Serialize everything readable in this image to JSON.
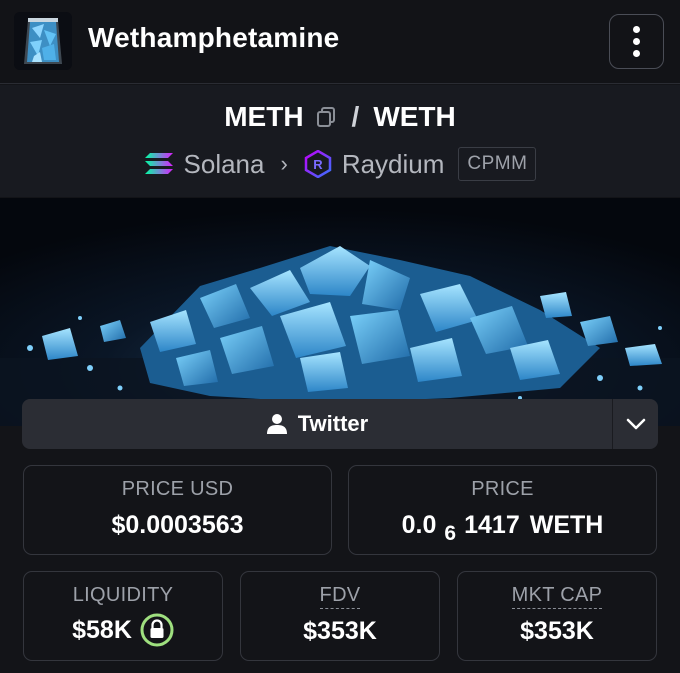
{
  "header": {
    "token_name": "Wethamphetamine",
    "menu_icon": "more-vertical-icon"
  },
  "pair": {
    "base": "METH",
    "separator": "/",
    "quote": "WETH",
    "chain": "Solana",
    "dex": "Raydium",
    "pool_type": "CPMM"
  },
  "social": {
    "twitter_label": "Twitter"
  },
  "stats": {
    "price_usd_label": "PRICE USD",
    "price_usd_value": "$0.0003563",
    "price_label": "PRICE",
    "price_prefix": "0.0",
    "price_zero_count": "6",
    "price_digits": "1417",
    "price_unit": "WETH",
    "liquidity_label": "LIQUIDITY",
    "liquidity_value": "$58K",
    "fdv_label": "FDV",
    "fdv_value": "$353K",
    "mktcap_label": "MKT CAP",
    "mktcap_value": "$353K"
  },
  "colors": {
    "background": "#131418",
    "card_border": "#34363d",
    "lock_green": "#9fe07f",
    "crystal_blue": "#5fc3f2"
  }
}
